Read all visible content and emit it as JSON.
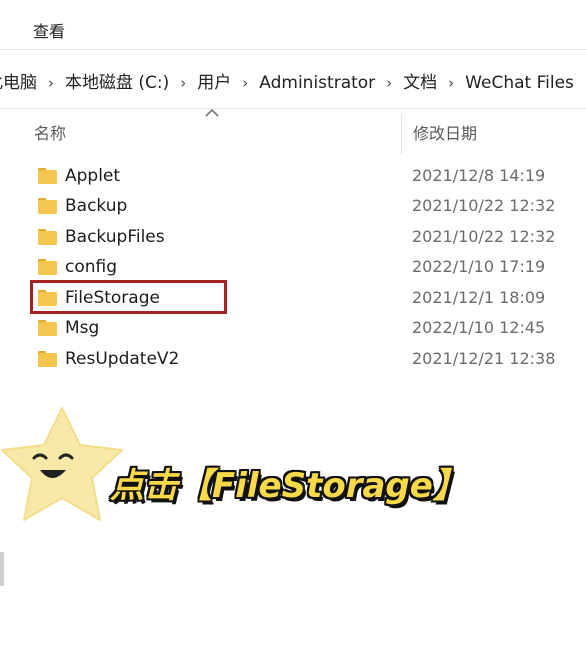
{
  "ribbon": {
    "view_tab": "查看"
  },
  "breadcrumb": [
    "此电脑",
    "本地磁盘 (C:)",
    "用户",
    "Administrator",
    "文档",
    "WeChat Files"
  ],
  "columns": {
    "name": "名称",
    "date": "修改日期"
  },
  "files": [
    {
      "name": "Applet",
      "date": "2021/12/8 14:19"
    },
    {
      "name": "Backup",
      "date": "2021/10/22 12:32"
    },
    {
      "name": "BackupFiles",
      "date": "2021/10/22 12:32"
    },
    {
      "name": "config",
      "date": "2022/1/10 17:19"
    },
    {
      "name": "FileStorage",
      "date": "2021/12/1 18:09"
    },
    {
      "name": "Msg",
      "date": "2022/1/10 12:45"
    },
    {
      "name": "ResUpdateV2",
      "date": "2021/12/21 12:38"
    }
  ],
  "highlighted_file": "FileStorage",
  "caption": "点击【FileStorage】",
  "colors": {
    "folder": "#f4c64e",
    "highlight_border": "#a32222",
    "caption_fill": "#f7d94a",
    "star": "#f9e9a8"
  },
  "icons": [
    "folder-icon",
    "chevron-right-icon",
    "sort-up-icon",
    "star-mascot-icon"
  ]
}
